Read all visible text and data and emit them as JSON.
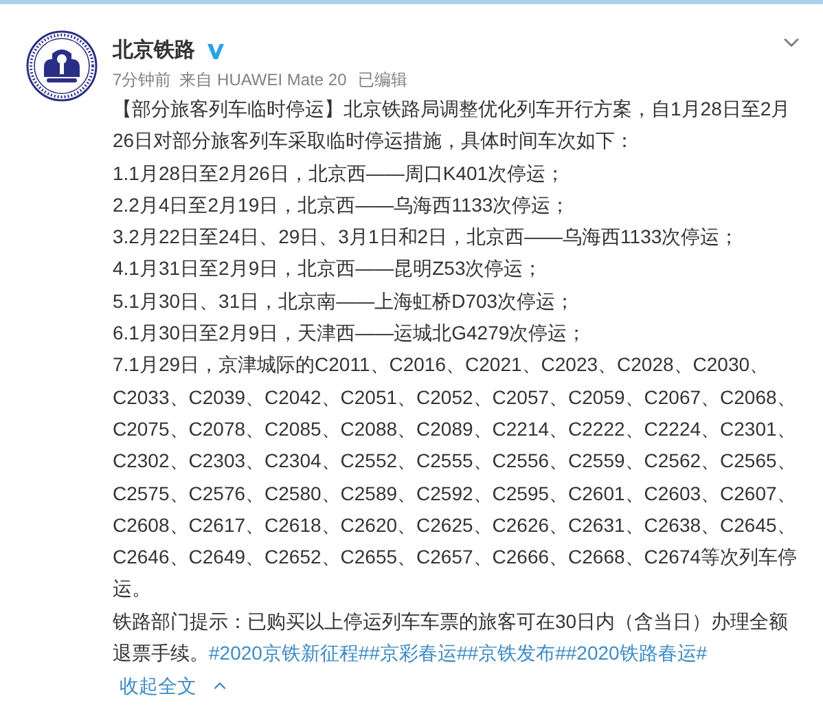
{
  "post": {
    "author": "北京铁路",
    "verified": true,
    "time": "7分钟前",
    "source": "来自 HUAWEI Mate 20",
    "edited": "已编辑",
    "lines": [
      {
        "text": "【部分旅客列车临时停运】北京铁路局调整优化列车开行方案，自1月28日至2月"
      },
      {
        "text": "26日对部分旅客列车采取临时停运措施，具体时间车次如下："
      },
      {
        "text": "1.1月28日至2月26日，北京西——周口K401次停运；"
      },
      {
        "text": "2.2月4日至2月19日，北京西——乌海西1133次停运；"
      },
      {
        "text": "3.2月22日至24日、29日、3月1日和2日，北京西——乌海西1133次停运；"
      },
      {
        "text": "4.1月31日至2月9日，北京西——昆明Z53次停运；"
      },
      {
        "text": "5.1月30日、31日，北京南——上海虹桥D703次停运；"
      },
      {
        "text": "6.1月30日至2月9日，天津西——运城北G4279次停运；"
      },
      {
        "text": "7.1月29日，京津城际的C2011、C2016、C2021、C2023、C2028、C2030、"
      },
      {
        "text": "C2033、C2039、C2042、C2051、C2052、C2057、C2059、C2067、C2068、"
      },
      {
        "text": "C2075、C2078、C2085、C2088、C2089、C2214、C2222、C2224、C2301、"
      },
      {
        "text": "C2302、C2303、C2304、C2552、C2555、C2556、C2559、C2562、C2565、"
      },
      {
        "text": "C2575、C2576、C2580、C2589、C2592、C2595、C2601、C2603、C2607、"
      },
      {
        "text": "C2608、C2617、C2618、C2620、C2625、C2626、C2631、C2638、C2645、"
      },
      {
        "text": "C2646、C2649、C2652、C2655、C2657、C2666、C2668、C2674等次列车停"
      },
      {
        "text": "运。"
      },
      {
        "text": "铁路部门提示：已购买以上停运列车车票的旅客可在30日内（含当日）办理全额"
      },
      {
        "text": "退票手续。",
        "hashtags": [
          "#2020京铁新征程#",
          "#京彩春运#",
          "#京铁发布#",
          "#2020铁路春运#"
        ]
      }
    ],
    "collapse": "收起全文"
  }
}
